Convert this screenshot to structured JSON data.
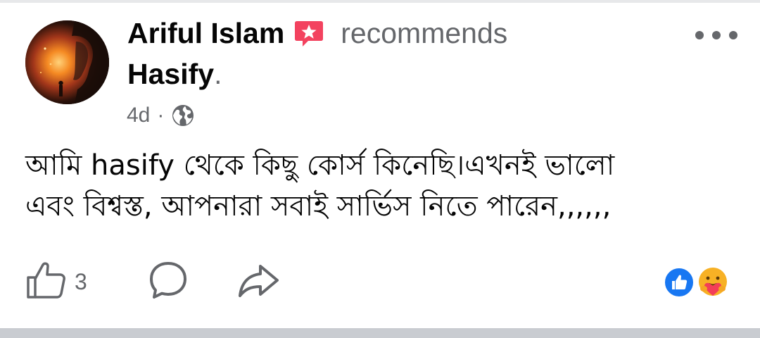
{
  "post": {
    "author": "Ariful Islam",
    "action_text": "recommends",
    "page_name": "Hasify",
    "page_suffix": ".",
    "time": "4d",
    "separator": "·",
    "privacy_icon": "globe-icon",
    "badge_icon": "recommendation-star-icon",
    "text_lines": [
      "আমি hasify থেকে কিছু কোর্স কিনেছি।এখনই ভালো",
      "এবং বিশ্বস্ত, আপনারা সবাই সার্ভিস নিতে পারেন,,,,,,"
    ]
  },
  "actions": {
    "like_icon": "thumbs-up-icon",
    "like_count": "3",
    "comment_icon": "comment-bubble-icon",
    "share_icon": "share-arrow-icon"
  },
  "reactions": [
    "like-reaction-icon",
    "care-reaction-icon"
  ],
  "colors": {
    "text_primary": "#050505",
    "text_secondary": "#65676b",
    "brand_blue": "#1877f2",
    "badge_pink": "#f3425f",
    "care_yellow": "#f7b125"
  }
}
